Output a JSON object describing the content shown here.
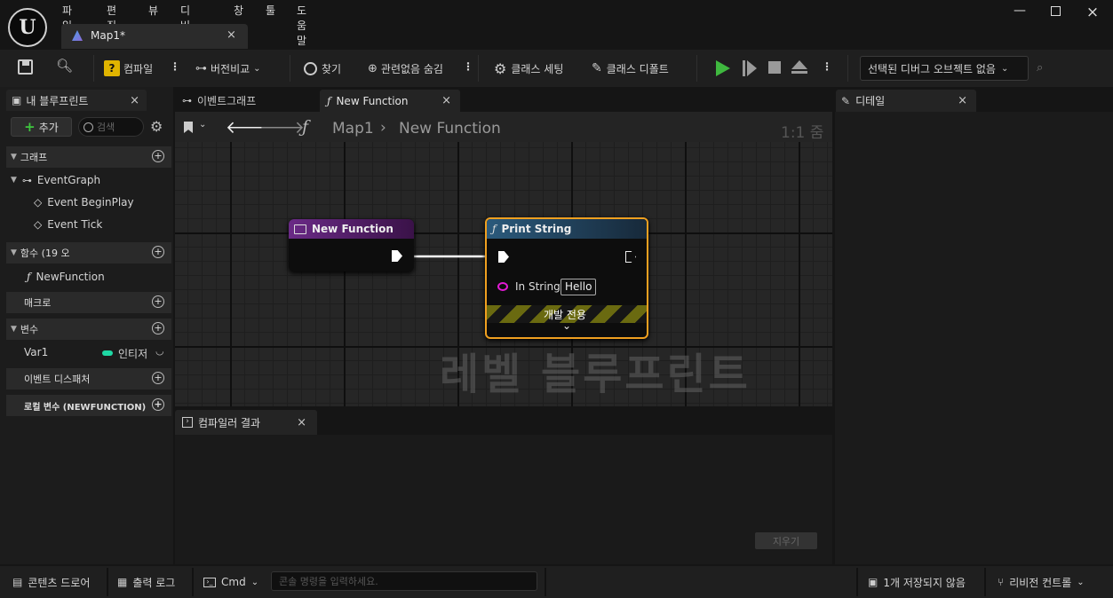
{
  "menu": [
    "파일",
    "편집",
    "뷰",
    "디버그",
    "창",
    "툴",
    "도움말"
  ],
  "doc_tab": {
    "title": "Map1*"
  },
  "toolbar": {
    "compile": "컴파일",
    "diff": "버전비교",
    "find": "찾기",
    "hide_unrelated": "관련없음 숨김",
    "class_settings": "클래스 세팅",
    "class_defaults": "클래스 디폴트",
    "debug_object": "선택된 디버그 오브젝트 없음"
  },
  "my_blueprint": {
    "tab": "내 블루프린트",
    "add": "추가",
    "search_placeholder": "검색",
    "sections": {
      "graphs": "그래프",
      "functions": "함수 (19 오",
      "macros": "매크로",
      "variables": "변수",
      "dispatchers": "이벤트 디스패처",
      "local_vars": "로컬 변수 (NEWFUNCTION)"
    },
    "event_graph": "EventGraph",
    "events": [
      "Event BeginPlay",
      "Event Tick"
    ],
    "function_item": "NewFunction",
    "var_name": "Var1",
    "var_type": "인티저"
  },
  "graph_tabs": {
    "event_graph": "이벤트그래프",
    "new_function": "New Function"
  },
  "breadcrumb": {
    "map": "Map1",
    "func": "New Function",
    "zoom": "1:1 줌"
  },
  "nodes": {
    "entry": {
      "title": "New Function"
    },
    "print": {
      "title": "Print String",
      "pin_label": "In String",
      "pin_value": "Hello",
      "dev_only": "개발 전용"
    }
  },
  "watermark": "레벨 블루프린트",
  "compiler_results": {
    "tab": "컴파일러 결과",
    "clear": "지우기"
  },
  "details": {
    "tab": "디테일"
  },
  "statusbar": {
    "content_drawer": "콘텐츠 드로어",
    "output_log": "출력 로그",
    "cmd": "Cmd",
    "console_placeholder": "콘솔 명령을 입력하세요.",
    "unsaved": "1개 저장되지 않음",
    "revision": "리비전 컨트롤"
  },
  "colors": {
    "accent_orange": "#f0a020",
    "function_header": "#5a1d74",
    "print_header": "#23425c",
    "var_integer": "#1ed8a4",
    "string_pin": "#e21ad4",
    "play": "#3fb83f"
  }
}
